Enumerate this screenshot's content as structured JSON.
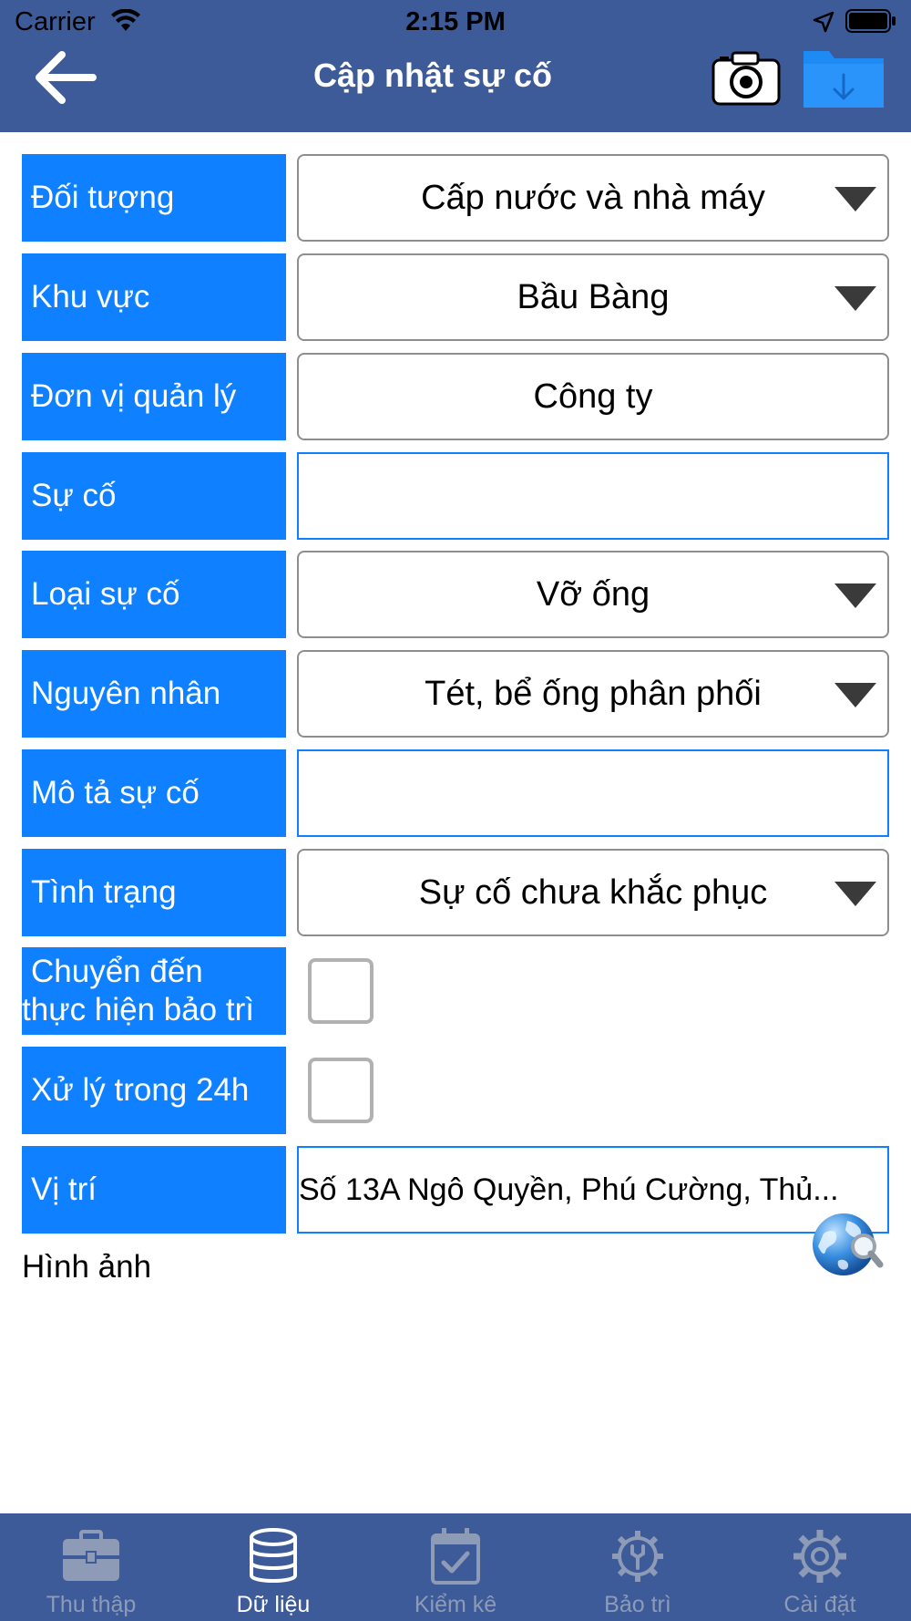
{
  "status_bar": {
    "carrier": "Carrier",
    "time": "2:15 PM"
  },
  "header": {
    "title": "Cập nhật sự cố",
    "background": "#3D5B98",
    "icons": [
      "back-arrow-icon",
      "camera-icon",
      "folder-download-icon"
    ]
  },
  "form": {
    "label_color": "#0F80FF",
    "rows": [
      {
        "label": "Đối tượng",
        "value": "Cấp nước và nhà máy"
      },
      {
        "label": "Khu vực",
        "value": "Bầu Bàng"
      },
      {
        "label": "Đơn vị quản lý",
        "value": "Công ty"
      },
      {
        "label": "Sự cố",
        "value": ""
      },
      {
        "label": "Loại sự cố",
        "value": "Vỡ ống"
      },
      {
        "label": "Nguyên nhân",
        "value": "Tét, bể ống phân phối"
      },
      {
        "label": "Mô tả sự cố",
        "value": ""
      },
      {
        "label": "Tình trạng",
        "value": "Sự cố chưa khắc phục"
      },
      {
        "label_line1": "Chuyển đến",
        "label_line2": "thực hiện bảo trì",
        "checked": false
      },
      {
        "label": "Xử lý trong 24h",
        "checked": false
      },
      {
        "label": "Vị trí",
        "value": "Số 13A Ngô Quyền, Phú Cường, Thủ..."
      }
    ],
    "images_label": "Hình ảnh"
  },
  "tabbar": {
    "active_index": 1,
    "tabs": [
      {
        "label": "Thu thập",
        "icon": "toolbox-icon"
      },
      {
        "label": "Dữ liệu",
        "icon": "database-icon"
      },
      {
        "label": "Kiểm kê",
        "icon": "calendar-check-icon"
      },
      {
        "label": "Bảo trì",
        "icon": "gear-wrench-icon"
      },
      {
        "label": "Cài đặt",
        "icon": "gear-icon"
      }
    ]
  }
}
